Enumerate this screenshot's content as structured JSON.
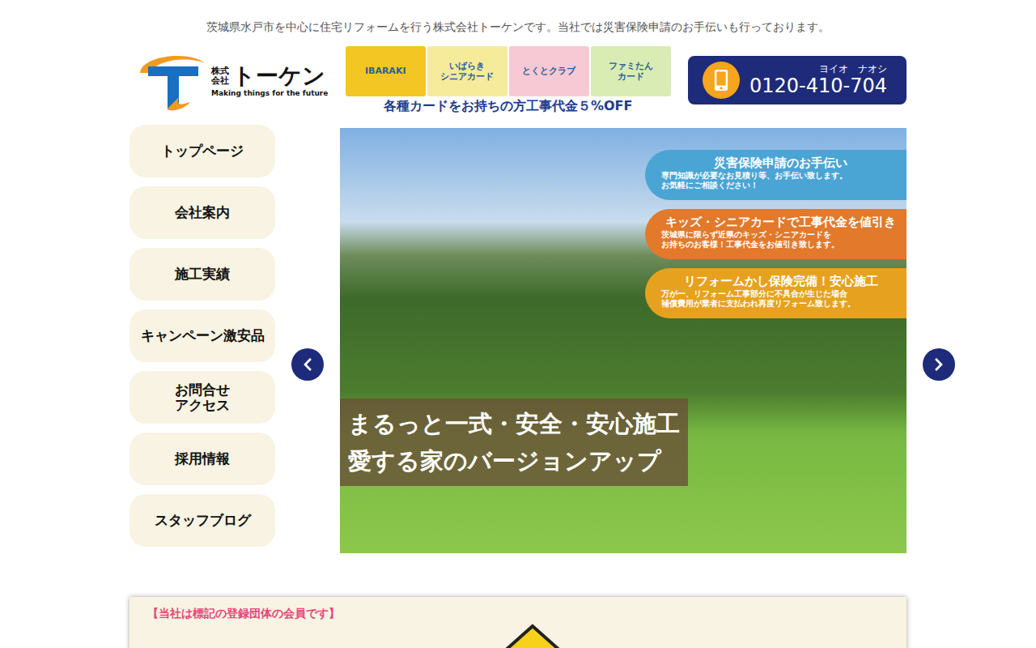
{
  "header_note": "茨城県水戸市を中心に住宅リフォームを行う株式会社トーケンです。当社では災害保険申請のお手伝いも行っております。",
  "logo": {
    "company_type": "株式\n会社",
    "name": "トーケン",
    "tagline": "Making things for the future"
  },
  "cards": [
    {
      "label": "IBARAKI",
      "color": "#f3c623"
    },
    {
      "label": "いばらき\nシニアカード",
      "color": "#f6eb9a"
    },
    {
      "label": "とくとクラブ",
      "color": "#f7c9d4"
    },
    {
      "label": "ファミたん\nカード",
      "color": "#d8ecb4"
    }
  ],
  "cards_caption": "各種カードをお持ちの方工事代金５%OFF",
  "phone": {
    "reading": "ヨイオ　ナオシ",
    "number": "0120-410-704"
  },
  "nav": [
    {
      "label": "トップページ"
    },
    {
      "label": "会社案内"
    },
    {
      "label": "施工実績"
    },
    {
      "label": "キャンペーン激安品"
    },
    {
      "label": "お問合せ\nアクセス"
    },
    {
      "label": "採用情報"
    },
    {
      "label": "スタッフブログ"
    }
  ],
  "slider": {
    "callouts": [
      {
        "title": "災害保険申請のお手伝い",
        "text": "専門知識が必要なお見積り等、お手伝い致します。\nお気軽にご相談ください！",
        "color": "#4aa5d5"
      },
      {
        "title": "キッズ・シニアカードで工事代金を値引き",
        "text": "茨城県に限らず近県のキッズ・シニアカードを\nお持ちのお客様！工事代金をお値引き致します。",
        "color": "#e2792b"
      },
      {
        "title": "リフォームかし保険完備！安心施工",
        "text": "万が一、リフォーム工事部分に不具合が生じた場合\n補償費用が業者に支払われ再度リフォーム致します。",
        "color": "#e6a21e"
      }
    ],
    "caption": "まるっと一式・安全・安心施工\n愛する家のバージョンアップ"
  },
  "members": {
    "title": "【当社は標記の登録団体の会員です】"
  }
}
